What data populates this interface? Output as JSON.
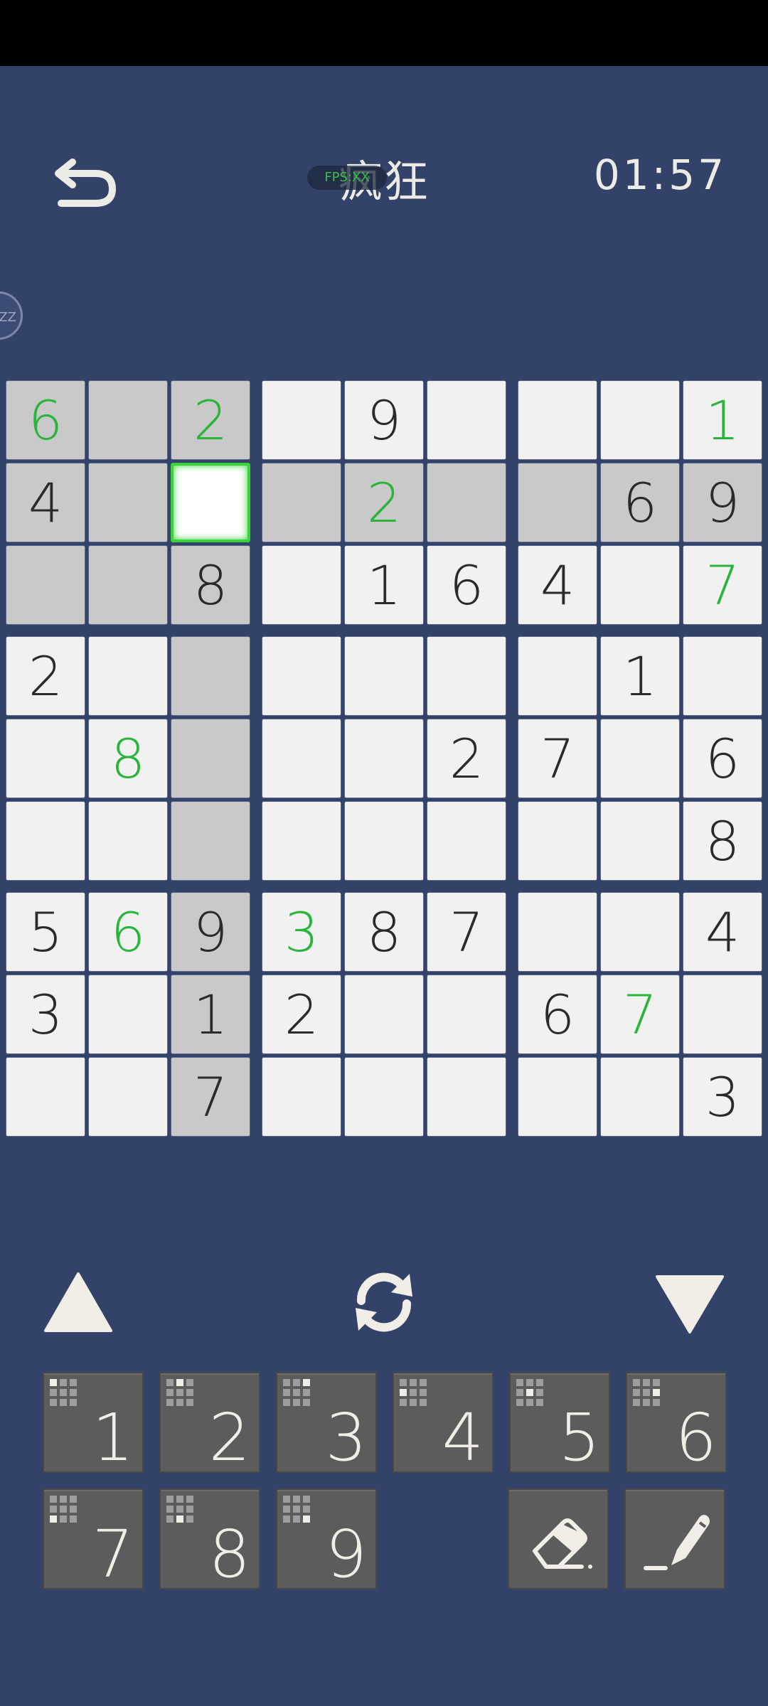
{
  "header": {
    "title": "疯狂",
    "timer": "01:57",
    "fps_badge": "FPS:XX"
  },
  "side_badge": "ZZ",
  "board": {
    "rows": [
      [
        "6",
        "",
        "2",
        "",
        "9",
        "",
        "",
        "",
        "1"
      ],
      [
        "4",
        "",
        "",
        "",
        "2",
        "",
        "",
        "6",
        "9"
      ],
      [
        "",
        "",
        "8",
        "",
        "1",
        "6",
        "4",
        "",
        "7"
      ],
      [
        "2",
        "",
        "",
        "",
        "",
        "",
        "",
        "1",
        ""
      ],
      [
        "",
        "8",
        "",
        "",
        "",
        "2",
        "7",
        "",
        "6"
      ],
      [
        "",
        "",
        "",
        "",
        "",
        "",
        "",
        "",
        "8"
      ],
      [
        "5",
        "6",
        "9",
        "3",
        "8",
        "7",
        "",
        "",
        "4"
      ],
      [
        "3",
        "",
        "1",
        "2",
        "",
        "",
        "6",
        "7",
        ""
      ],
      [
        "",
        "",
        "7",
        "",
        "",
        "",
        "",
        "",
        "3"
      ]
    ],
    "user_entered": [
      [
        0,
        0
      ],
      [
        0,
        2
      ],
      [
        0,
        8
      ],
      [
        1,
        4
      ],
      [
        2,
        8
      ],
      [
        4,
        1
      ],
      [
        6,
        1
      ],
      [
        6,
        3
      ],
      [
        7,
        7
      ]
    ],
    "selected_cell": [
      1,
      2
    ],
    "colors": {
      "background": "#324268",
      "cell": "#f1f1f1",
      "highlight": "#c9c9c9",
      "user_digit": "#2ab43c",
      "given_digit": "#2a2a2a",
      "selection": "#3ad33a"
    }
  },
  "controls": {
    "up_icon": "triangle-up-icon",
    "refresh_icon": "refresh-icon",
    "down_icon": "triangle-down-icon",
    "numbers": [
      "1",
      "2",
      "3",
      "4",
      "5",
      "6",
      "7",
      "8",
      "9"
    ],
    "eraser_icon": "eraser-icon",
    "pencil_icon": "pencil-icon",
    "button_color": "#5c5c5c"
  }
}
